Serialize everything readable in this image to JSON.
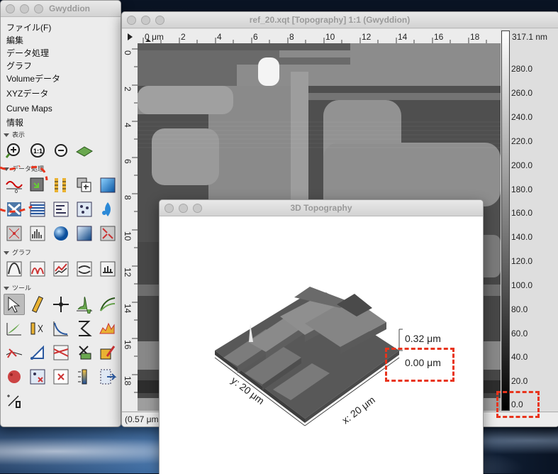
{
  "toolbox": {
    "title": "Gwyddion",
    "menu": [
      "ファイル(F)",
      "編集",
      "データ処理",
      "グラフ",
      "Volumeデータ",
      "XYZデータ",
      "Curve Maps",
      "情報"
    ],
    "sections": {
      "view": "表示",
      "process": "データ処理",
      "graph": "グラフ",
      "tools": "ツール"
    },
    "view_icons": [
      "zoom-in-icon",
      "zoom-1to1-icon",
      "zoom-out-icon",
      "3d-view-icon"
    ],
    "process_icons": [
      "fix-zero-icon",
      "crop-icon",
      "scale-icon",
      "duplicate-icon",
      "gradient-icon",
      "rotate-icon",
      "level-rows-icon",
      "flatten-icon",
      "grains-icon",
      "watershed-icon",
      "fft-icon",
      "histogram-icon",
      "sphere-icon",
      "shade-icon",
      "mask-icon"
    ],
    "graph_icons": [
      "graph-fit-icon",
      "graph-peaks-icon",
      "graph-compare-icon",
      "graph-sfunc-icon",
      "graph-export-icon"
    ],
    "tool_icons": [
      "pointer-icon",
      "distance-icon",
      "crosshair-icon",
      "profile-icon",
      "roughness-icon",
      "stats-icon",
      "filter-icon",
      "spectro-icon",
      "path-level-icon",
      "grain-measure-icon",
      "level3-icon",
      "triangle-icon",
      "mask-editor-icon",
      "crop-tool-icon",
      "remove-spots-icon",
      "blob-icon",
      "remove-grains-icon",
      "colorrange-icon",
      "selection-icon",
      "line-stats-icon"
    ]
  },
  "data_window": {
    "title": "ref_20.xqt [Topography] 1:1 (Gwyddion)",
    "x_ruler_labels": [
      "0 μm",
      "2",
      "4",
      "6",
      "8",
      "10",
      "12",
      "14",
      "16",
      "18"
    ],
    "y_ruler_labels": [
      "0 μm",
      "2",
      "4",
      "6",
      "8",
      "10",
      "12",
      "14",
      "16",
      "18"
    ],
    "colorbar_max": "317.1 nm",
    "colorbar_ticks": [
      "280.0",
      "260.0",
      "240.0",
      "220.0",
      "200.0",
      "180.0",
      "160.0",
      "140.0",
      "120.0",
      "100.0",
      "80.0",
      "60.0",
      "40.0",
      "20.0",
      "0.0"
    ],
    "status": "(0.57 μm"
  },
  "win3d": {
    "title": "3D Topography",
    "z_max": "0.32 μm",
    "z_min": "0.00 μm",
    "x_axis": "x: 20 μm",
    "y_axis": "y: 20 μm"
  }
}
